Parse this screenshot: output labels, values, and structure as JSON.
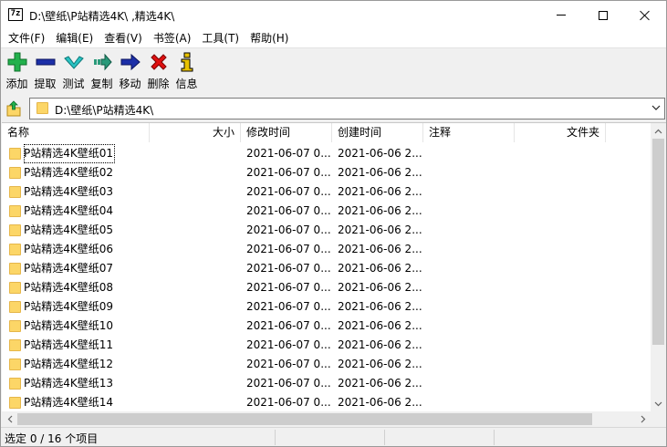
{
  "window": {
    "app_icon_text": "7z",
    "title": "D:\\壁纸\\P站精选4K\\   ‚精选4K\\"
  },
  "menu": [
    "文件(F)",
    "编辑(E)",
    "查看(V)",
    "书签(A)",
    "工具(T)",
    "帮助(H)"
  ],
  "toolbar": [
    {
      "label": "添加",
      "icon": "plus-icon",
      "color": "#22b14c"
    },
    {
      "label": "提取",
      "icon": "minus-icon",
      "color": "#1c2fa8"
    },
    {
      "label": "测试",
      "icon": "check-icon",
      "color": "#29c3c3"
    },
    {
      "label": "复制",
      "icon": "copy-arrow-icon",
      "color": "#2a9a7a"
    },
    {
      "label": "移动",
      "icon": "move-arrow-icon",
      "color": "#1c2fa8"
    },
    {
      "label": "删除",
      "icon": "delete-x-icon",
      "color": "#e01010"
    },
    {
      "label": "信息",
      "icon": "info-icon",
      "color": "#e8c200"
    }
  ],
  "address": {
    "path": "D:\\壁纸\\P站精选4K\\"
  },
  "columns": [
    {
      "label": "名称",
      "align": "left"
    },
    {
      "label": "大小",
      "align": "right"
    },
    {
      "label": "修改时间",
      "align": "left"
    },
    {
      "label": "创建时间",
      "align": "left"
    },
    {
      "label": "注释",
      "align": "left"
    },
    {
      "label": "文件夹",
      "align": "right"
    }
  ],
  "rows": [
    {
      "name": "P站精选4K壁纸01",
      "size": "",
      "modified": "2021-06-07 0...",
      "created": "2021-06-06 2...",
      "comment": "",
      "folders": ""
    },
    {
      "name": "P站精选4K壁纸02",
      "size": "",
      "modified": "2021-06-07 0...",
      "created": "2021-06-06 2...",
      "comment": "",
      "folders": ""
    },
    {
      "name": "P站精选4K壁纸03",
      "size": "",
      "modified": "2021-06-07 0...",
      "created": "2021-06-06 2...",
      "comment": "",
      "folders": ""
    },
    {
      "name": "P站精选4K壁纸04",
      "size": "",
      "modified": "2021-06-07 0...",
      "created": "2021-06-06 2...",
      "comment": "",
      "folders": ""
    },
    {
      "name": "P站精选4K壁纸05",
      "size": "",
      "modified": "2021-06-07 0...",
      "created": "2021-06-06 2...",
      "comment": "",
      "folders": ""
    },
    {
      "name": "P站精选4K壁纸06",
      "size": "",
      "modified": "2021-06-07 0...",
      "created": "2021-06-06 2...",
      "comment": "",
      "folders": ""
    },
    {
      "name": "P站精选4K壁纸07",
      "size": "",
      "modified": "2021-06-07 0...",
      "created": "2021-06-06 2...",
      "comment": "",
      "folders": ""
    },
    {
      "name": "P站精选4K壁纸08",
      "size": "",
      "modified": "2021-06-07 0...",
      "created": "2021-06-06 2...",
      "comment": "",
      "folders": ""
    },
    {
      "name": "P站精选4K壁纸09",
      "size": "",
      "modified": "2021-06-07 0...",
      "created": "2021-06-06 2...",
      "comment": "",
      "folders": ""
    },
    {
      "name": "P站精选4K壁纸10",
      "size": "",
      "modified": "2021-06-07 0...",
      "created": "2021-06-06 2...",
      "comment": "",
      "folders": ""
    },
    {
      "name": "P站精选4K壁纸11",
      "size": "",
      "modified": "2021-06-07 0...",
      "created": "2021-06-06 2...",
      "comment": "",
      "folders": ""
    },
    {
      "name": "P站精选4K壁纸12",
      "size": "",
      "modified": "2021-06-07 0...",
      "created": "2021-06-06 2...",
      "comment": "",
      "folders": ""
    },
    {
      "name": "P站精选4K壁纸13",
      "size": "",
      "modified": "2021-06-07 0...",
      "created": "2021-06-06 2...",
      "comment": "",
      "folders": ""
    },
    {
      "name": "P站精选4K壁纸14",
      "size": "",
      "modified": "2021-06-07 0...",
      "created": "2021-06-06 2...",
      "comment": "",
      "folders": ""
    }
  ],
  "status": {
    "text": "选定 0 / 16 个项目"
  }
}
